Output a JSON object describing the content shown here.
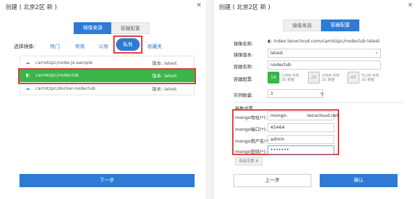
{
  "left": {
    "title": "创建 ( 北京2区 新 )",
    "close": "✕",
    "tabs": [
      "镜像来源",
      "容器配置"
    ],
    "category_label": "选择镜像:",
    "categories": [
      "热门",
      "常用",
      "公有",
      "私有",
      "收藏夹"
    ],
    "rows": [
      {
        "icon": "cloud-icon",
        "name": "carrotzpc/node-js-sample",
        "version": "版本: latest"
      },
      {
        "icon": "codeship-icon",
        "name": "carrotzpc/nodeclub",
        "version": "版本: latest"
      },
      {
        "icon": "cloud-icon",
        "name": "carrotzpc/docker-nodeclub",
        "version": "版本: latest"
      }
    ],
    "next": "下一步"
  },
  "right": {
    "title": "创建 ( 北京2区 新 )",
    "close": "✕",
    "tabs": [
      "镜像来源",
      "容器配置"
    ],
    "image_name_label": "镜像名称:",
    "image_name": "index.tenxcloud.com/carrotzpc/nodeclub:latest",
    "image_version_label": "镜像版本:",
    "image_version": "latest",
    "container_name_label": "容器名称:",
    "container_name": "nodeclub",
    "container_cfg_label": "容器配置:",
    "cfg_options": [
      {
        "size": "1X",
        "mem": "128M 内存",
        "disk": "2G 硬盘"
      },
      {
        "size": "2X",
        "mem": "256M 内存",
        "disk": "2G 硬盘"
      },
      {
        "size": "4X",
        "mem": "512M 内存",
        "disk": "2G 硬盘"
      }
    ],
    "instances_label": "实例数量:",
    "instances": "1",
    "instances_unit": "个",
    "section": "参数设置",
    "env": [
      {
        "label": "mongo地址(*):",
        "value": "mongo-    .tenxcloud.net"
      },
      {
        "label": "mongo端口(*):",
        "value": "45464"
      },
      {
        "label": "mongo用户名(*):",
        "value": "admin"
      },
      {
        "label": "mongo密码(*):",
        "value": "•••••••"
      }
    ],
    "advanced": "高级设置 ⊕",
    "prev": "上一步",
    "ok": "确认"
  },
  "colors": {
    "accent": "#2d7bd4",
    "selected": "#39b54a",
    "highlight": "#e03c3c"
  }
}
